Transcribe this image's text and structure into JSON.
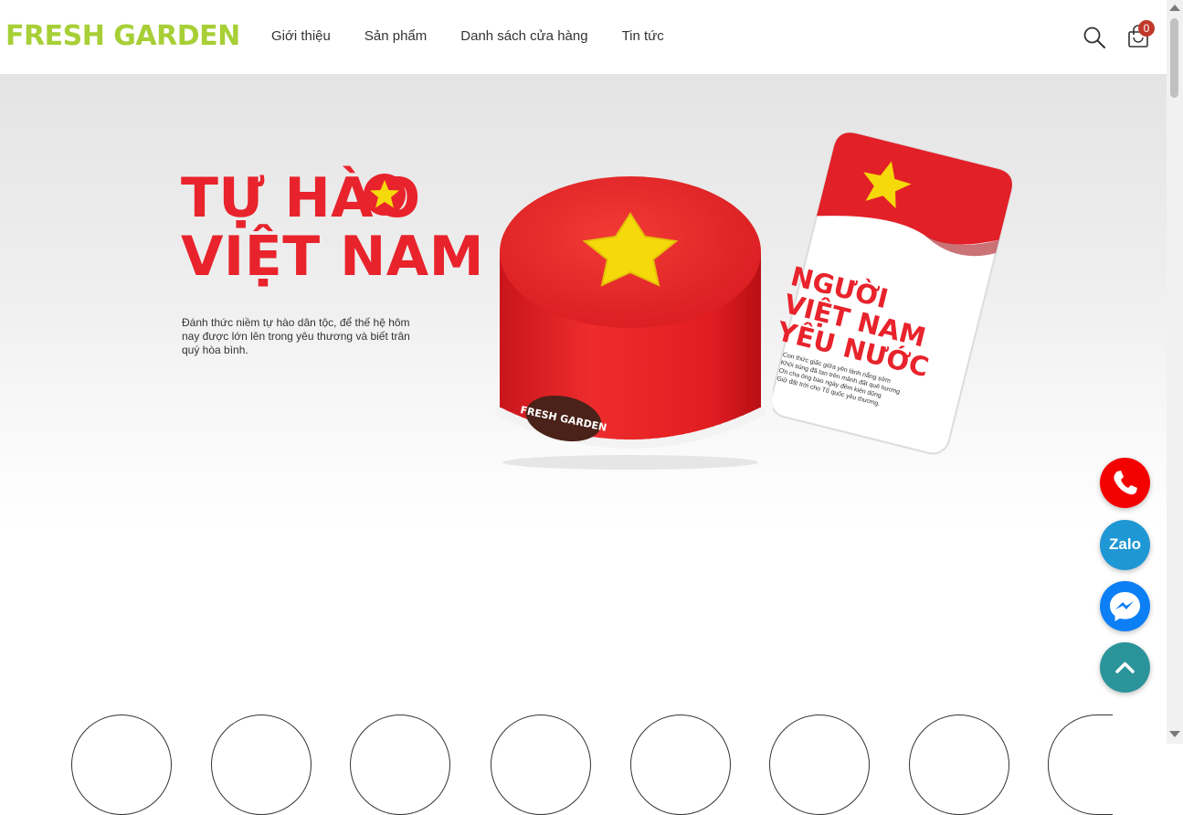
{
  "header": {
    "logo": "FRESH GARDEN",
    "nav": [
      "Giới thiệu",
      "Sản phẩm",
      "Danh sách cửa hàng",
      "Tin tức"
    ],
    "cart_count": "0",
    "icons": [
      "search-icon",
      "cart-icon"
    ]
  },
  "hero": {
    "title": "TỰ HÀO\nVIỆT NAM",
    "description": "Đánh thức niềm tự hào dân tộc, để thế hệ hôm nay được lớn lên trong yêu thương và biết trân quý hòa bình.",
    "cake_badge": "FRESH GARDEN",
    "card_title": "NGƯỜI\nVIỆT NAM\nYÊU NƯỚC",
    "card_text": "Con thức giấc giữa yên lành nắng sớm\nKhói súng đã tan trên mảnh đất quê hương\nƠn cha ông bao ngày đêm kiên dũng\nGiữ đất trời cho Tổ quốc yêu thương.",
    "colors": {
      "red": "#e8232c",
      "yellow": "#f5d90a",
      "brand_green": "#a7cf36"
    }
  },
  "floating_buttons": {
    "zalo_label": "Zalo",
    "icons": [
      "phone-icon",
      "zalo-icon",
      "messenger-icon",
      "arrow-up-icon"
    ]
  }
}
